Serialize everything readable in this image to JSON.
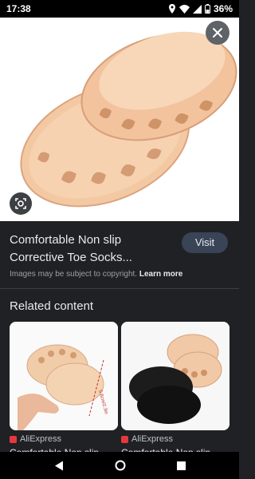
{
  "status": {
    "time": "17:38",
    "battery": "36%"
  },
  "product": {
    "title": "Comfortable Non slip Corrective Toe Socks...",
    "visit_label": "Visit",
    "copyright_text": "Images may be subject to copyright.",
    "learn_more": "Learn more"
  },
  "related": {
    "heading": "Related content",
    "items": [
      {
        "source": "AliExpress",
        "caption": "Comfortable Non slip",
        "measure_label": "5.8cm/2.3in"
      },
      {
        "source": "AliExpress",
        "caption": "Comfortable Non slip"
      }
    ]
  },
  "colors": {
    "background": "#202124",
    "visit_button": "#394457",
    "aliexpress": "#e4393c"
  },
  "icons": [
    "location-icon",
    "wifi-icon",
    "signal-icon",
    "battery-icon",
    "close-icon",
    "lens-icon",
    "back-icon",
    "home-icon",
    "recents-icon"
  ]
}
